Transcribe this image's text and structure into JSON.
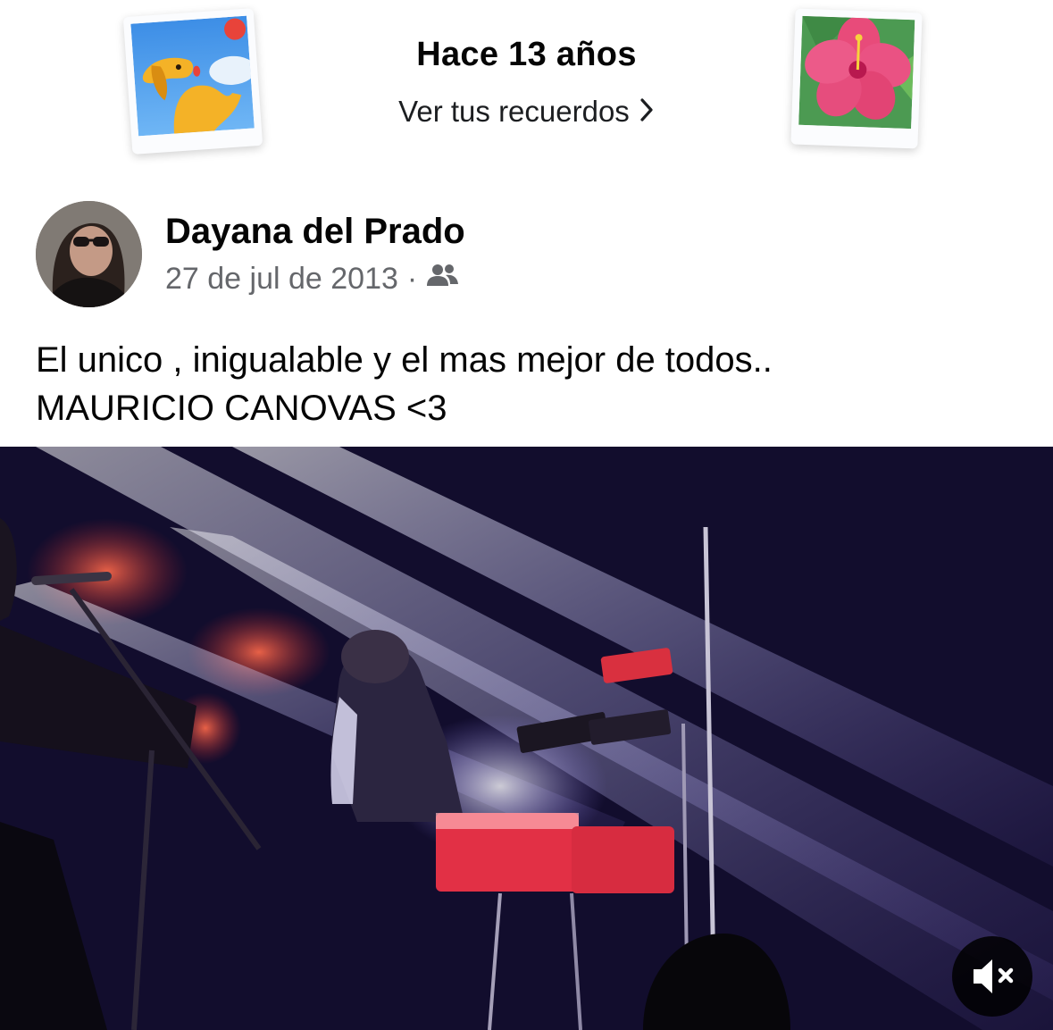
{
  "memories": {
    "title": "Hace 13 años",
    "link_label": "Ver tus recuerdos",
    "left_sticker": "dog-photo-icon",
    "right_sticker": "hibiscus-photo-icon"
  },
  "post": {
    "author": "Dayana del Prado",
    "date": "27 de jul de 2013",
    "separator": "·",
    "audience_icon": "friends-icon",
    "text_line1": "El unico , inigualable y el mas mejor de todos..",
    "text_line2": "MAURICIO CANOVAS <3"
  },
  "video": {
    "muted": true,
    "mute_icon": "speaker-muted-icon"
  },
  "colors": {
    "text_primary": "#050505",
    "text_secondary": "#65676b",
    "background": "#ffffff"
  }
}
